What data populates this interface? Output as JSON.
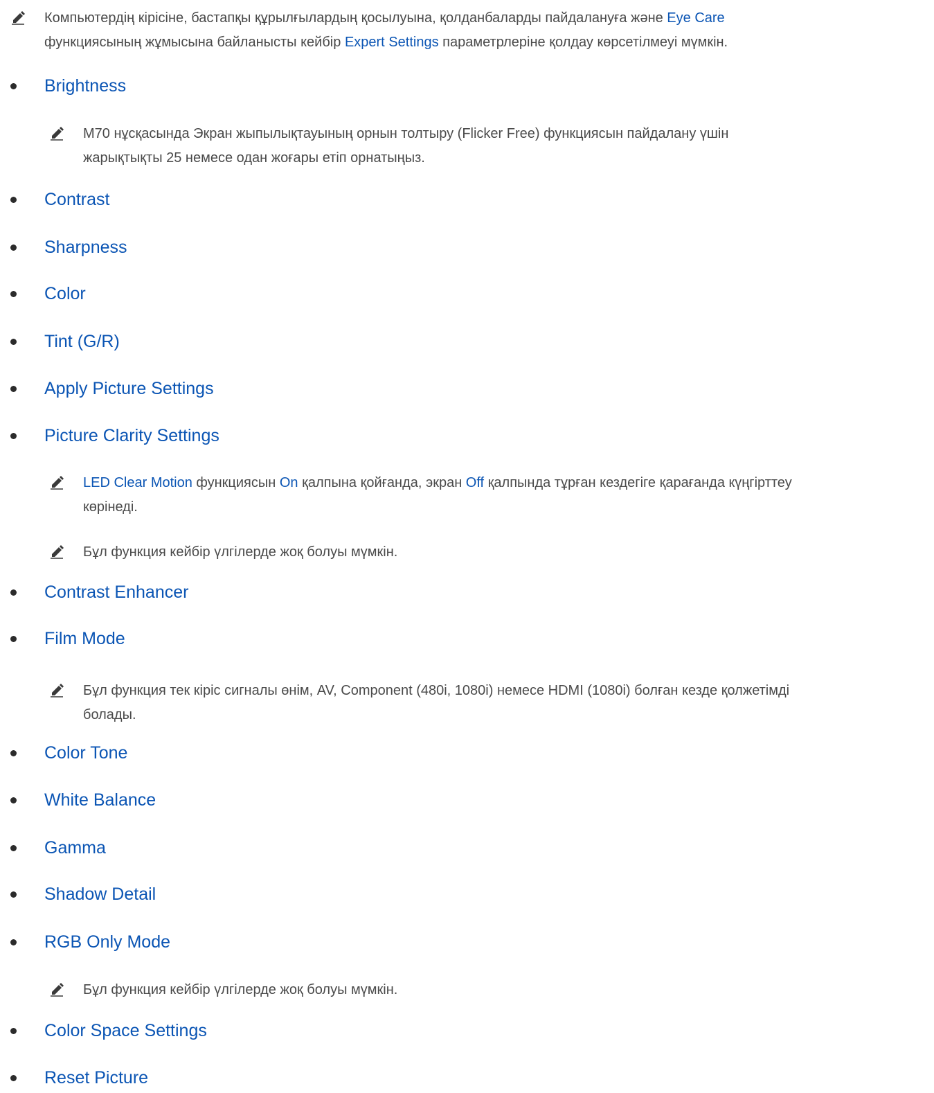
{
  "intro_note": {
    "t1": "Компьютердің кірісіне, бастапқы құрылғылардың қосылуына, қолданбаларды пайдалануға және ",
    "t2": "Eye Care",
    "t3": "функциясының жұмысына байланысты кейбір ",
    "t4": "Expert Settings",
    "t5": " параметрлеріне қолдау көрсетілмеуі мүмкін."
  },
  "items": [
    {
      "label": "Brightness"
    },
    {
      "label": "Contrast"
    },
    {
      "label": "Sharpness"
    },
    {
      "label": "Color"
    },
    {
      "label": "Tint (G/R)"
    },
    {
      "label": "Apply Picture Settings"
    },
    {
      "label": "Picture Clarity Settings"
    },
    {
      "label": "Contrast Enhancer"
    },
    {
      "label": "Film Mode"
    },
    {
      "label": "Color Tone"
    },
    {
      "label": "White Balance"
    },
    {
      "label": "Gamma"
    },
    {
      "label": "Shadow Detail"
    },
    {
      "label": "RGB Only Mode"
    },
    {
      "label": "Color Space Settings"
    },
    {
      "label": "Reset Picture"
    }
  ],
  "notes": {
    "brightness": {
      "line1": "M70 нұсқасында Экран жыпылықтауының орнын толтыру (Flicker Free) функциясын пайдалану үшін",
      "line2": "жарықтықты 25 немесе одан жоғары етіп орнатыңыз."
    },
    "clarity_led": {
      "t1": "LED Clear Motion",
      "t2": " функциясын ",
      "t3": "On",
      "t4": " қалпына қойғанда, экран ",
      "t5": "Off",
      "t6": " қалпында тұрған кездегіге қарағанда күңгірттеу",
      "line2": "көрінеді."
    },
    "clarity_model": "Бұл функция кейбір үлгілерде жоқ болуы мүмкін.",
    "film_mode": {
      "line1": "Бұл функция тек кіріс сигналы өнім, AV, Component (480i, 1080i) немесе HDMI (1080i) болған кезде қолжетімді",
      "line2": "болады."
    },
    "rgb_model": "Бұл функция кейбір үлгілерде жоқ болуы мүмкін."
  }
}
